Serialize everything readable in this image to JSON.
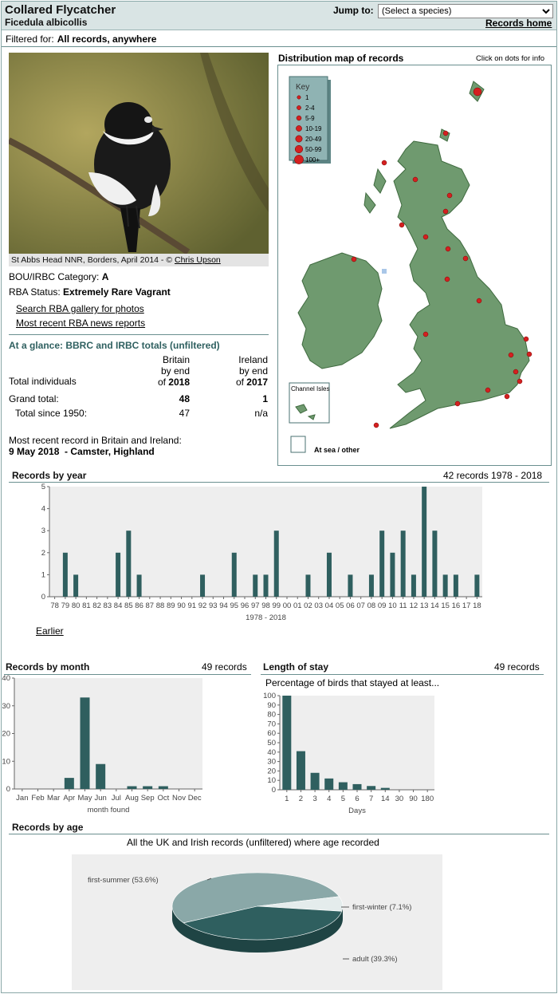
{
  "header": {
    "species": "Collared Flycatcher",
    "latin": "Ficedula albicollis",
    "jump_label": "Jump to:",
    "select_value": "(Select a species)",
    "home": "Records home"
  },
  "filter": {
    "label": "Filtered for:",
    "value": "All records, anywhere"
  },
  "photo": {
    "caption": "St Abbs Head NNR, Borders, April 2014 - © ",
    "credit": "Chris Upson"
  },
  "info": {
    "bou_label": "BOU/IRBC Category:",
    "bou_value": "A",
    "rba_label": "RBA Status:",
    "rba_value": "Extremely Rare Vagrant",
    "link_gallery": "Search RBA gallery for photos",
    "link_news": "Most recent RBA news reports"
  },
  "glance": {
    "title": "At a glance: BBRC and IRBC totals (unfiltered)",
    "col1_l1": "Britain",
    "col1_l2": "by end",
    "col1_l3": "of",
    "col1_year": "2018",
    "col2_l1": "Ireland",
    "col2_l2": "by end",
    "col2_l3": "of",
    "col2_year": "2017",
    "row0": "Total individuals",
    "row1": "Grand total:",
    "row1_b": "48",
    "row1_i": "1",
    "row2": "Total since 1950:",
    "row2_b": "47",
    "row2_i": "n/a",
    "recent_label": "Most recent record in Britain and Ireland:",
    "recent_value": "9 May 2018  - Camster, Highland"
  },
  "map": {
    "title": "Distribution map of records",
    "hint": "Click on dots for info",
    "key_title": "Key",
    "key": [
      "1",
      "2-4",
      "5-9",
      "10-19",
      "20-49",
      "50-99",
      "100+"
    ],
    "channel": "Channel Isles",
    "atsea": "At sea / other",
    "colors": {
      "land": "#6f9a6f",
      "dot": "#d42020",
      "keybg": "#8fb3b3"
    }
  },
  "year_chart": {
    "title": "Records by year",
    "subtitle": "42 records 1978 - 2018",
    "xlabel": "1978 - 2018",
    "earlier": "Earlier"
  },
  "month_chart": {
    "title": "Records by month",
    "subtitle": "49 records",
    "xlabel": "month found"
  },
  "stay_chart": {
    "title": "Length of stay",
    "subtitle": "49 records",
    "heading": "Percentage of birds that stayed at least...",
    "xlabel": "Days"
  },
  "age_chart": {
    "title": "Records by age",
    "heading": "All the UK and Irish records (unfiltered) where age recorded"
  },
  "chart_data": [
    {
      "type": "bar",
      "title": "Records by year",
      "categories": [
        "78",
        "79",
        "80",
        "81",
        "82",
        "83",
        "84",
        "85",
        "86",
        "87",
        "88",
        "89",
        "90",
        "91",
        "92",
        "93",
        "94",
        "95",
        "96",
        "97",
        "98",
        "99",
        "00",
        "01",
        "02",
        "03",
        "04",
        "05",
        "06",
        "07",
        "08",
        "09",
        "10",
        "11",
        "12",
        "13",
        "14",
        "15",
        "16",
        "17",
        "18"
      ],
      "values": [
        0,
        2,
        1,
        0,
        0,
        0,
        2,
        3,
        1,
        0,
        0,
        0,
        0,
        0,
        1,
        0,
        0,
        2,
        0,
        1,
        1,
        3,
        0,
        0,
        1,
        0,
        2,
        0,
        1,
        0,
        1,
        3,
        2,
        3,
        1,
        5,
        3,
        1,
        1,
        0,
        1
      ],
      "ylim": [
        0,
        5
      ],
      "xlabel": "1978 - 2018",
      "color": "#2f5f5f"
    },
    {
      "type": "bar",
      "title": "Records by month",
      "categories": [
        "Jan",
        "Feb",
        "Mar",
        "Apr",
        "May",
        "Jun",
        "Jul",
        "Aug",
        "Sep",
        "Oct",
        "Nov",
        "Dec"
      ],
      "values": [
        0,
        0,
        0,
        4,
        33,
        9,
        0,
        1,
        1,
        1,
        0,
        0
      ],
      "ylim": [
        0,
        40
      ],
      "xlabel": "month found",
      "color": "#2f5f5f"
    },
    {
      "type": "bar",
      "title": "Length of stay",
      "categories": [
        "1",
        "2",
        "3",
        "4",
        "5",
        "6",
        "7",
        "14",
        "30",
        "90",
        "180"
      ],
      "values": [
        100,
        41,
        18,
        12,
        8,
        6,
        4,
        2,
        0,
        0,
        0
      ],
      "ylim": [
        0,
        100
      ],
      "xlabel": "Days",
      "color": "#2f5f5f"
    },
    {
      "type": "pie",
      "title": "Records by age",
      "labels": [
        "first-summer",
        "first-winter",
        "adult"
      ],
      "values": [
        53.6,
        7.1,
        39.3
      ],
      "label_text": [
        "first-summer (53.6%)",
        "first-winter (7.1%)",
        "adult (39.3%)"
      ],
      "colors": [
        "#8aa8a8",
        "#e4ecec",
        "#2f5f5f"
      ]
    }
  ]
}
